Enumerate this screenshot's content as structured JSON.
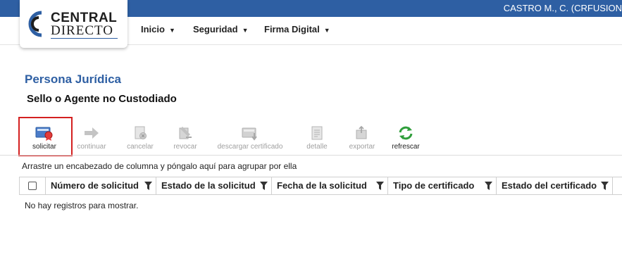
{
  "header": {
    "user": "CASTRO M., C. (CRFUSION"
  },
  "logo": {
    "line1": "CENTRAL",
    "line2": "DIRECTO"
  },
  "nav": {
    "items": [
      {
        "label": "Inicio"
      },
      {
        "label": "Seguridad"
      },
      {
        "label": "Firma Digital"
      }
    ]
  },
  "page": {
    "title": "Persona Jurídica",
    "subtitle": "Sello o Agente no Custodiado"
  },
  "toolbar": {
    "buttons": [
      {
        "label": "solicitar",
        "icon": "certificate-request-icon",
        "enabled": true
      },
      {
        "label": "continuar",
        "icon": "arrow-right-icon",
        "enabled": false
      },
      {
        "label": "cancelar",
        "icon": "document-cancel-icon",
        "enabled": false
      },
      {
        "label": "revocar",
        "icon": "revoke-icon",
        "enabled": false
      },
      {
        "label": "descargar certificado",
        "icon": "download-certificate-icon",
        "enabled": false
      },
      {
        "label": "detalle",
        "icon": "detail-icon",
        "enabled": false
      },
      {
        "label": "exportar",
        "icon": "export-icon",
        "enabled": false
      },
      {
        "label": "refrescar",
        "icon": "refresh-icon",
        "enabled": true
      }
    ]
  },
  "grid": {
    "group_hint": "Arrastre un encabezado de columna y póngalo aquí para agrupar por ella",
    "columns": [
      "Número de solicitud",
      "Estado de la solicitud",
      "Fecha de la solicitud",
      "Tipo de certificado",
      "Estado del certificado"
    ],
    "empty_message": "No hay registros para mostrar."
  },
  "colors": {
    "topbar": "#2e5fa3",
    "title": "#2e5fa3",
    "highlight": "#d42020"
  }
}
